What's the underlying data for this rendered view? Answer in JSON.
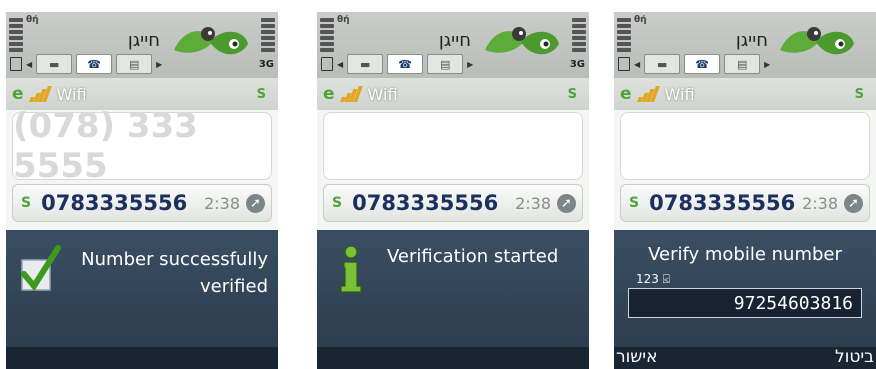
{
  "status": {
    "network_mark": "θή",
    "net_type": "3G"
  },
  "app": {
    "name": "חייגן"
  },
  "connection": {
    "label": "Wifi"
  },
  "screens": [
    {
      "dial_display": "(078) 333 5555",
      "recent_call": {
        "number": "0783335556",
        "time": "2:38"
      },
      "dialog": {
        "line1": "Number successfully",
        "line2": "verified",
        "icon": "checkmark-icon"
      }
    },
    {
      "dial_display": "",
      "recent_call": {
        "number": "0783335556",
        "time": "2:38"
      },
      "dialog": {
        "text": "Verification started",
        "icon": "info-icon"
      }
    },
    {
      "dial_display": "",
      "recent_call": {
        "number": "0783335556",
        "time": "2:38"
      },
      "dialog": {
        "title": "Verify mobile number",
        "input_mode": "123 ⍃",
        "input_value": "97254603816",
        "left_softkey": "אישור",
        "right_softkey": "ביטול"
      }
    }
  ],
  "colors": {
    "dialog_bg": "#33465a",
    "accent_green": "#4fa53a",
    "number_text": "#1c3060"
  }
}
